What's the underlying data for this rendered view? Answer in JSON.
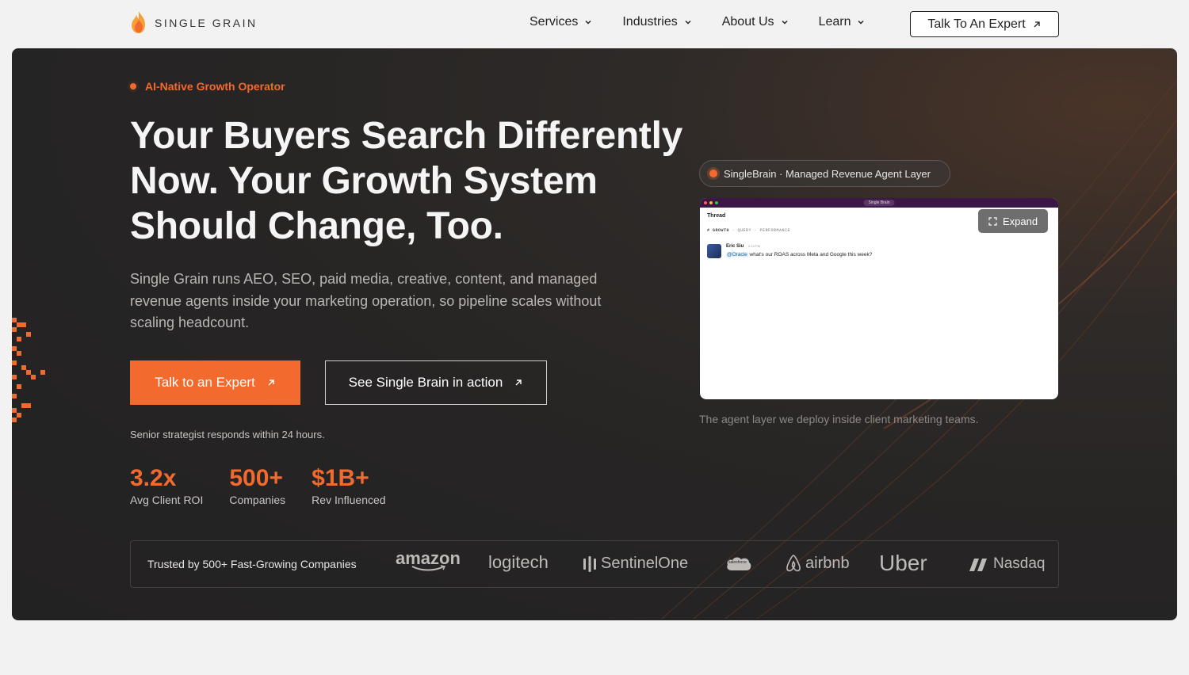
{
  "nav": {
    "logo_text": "SINGLE GRAIN",
    "items": [
      {
        "label": "Services"
      },
      {
        "label": "Industries"
      },
      {
        "label": "About Us"
      },
      {
        "label": "Learn"
      }
    ],
    "cta_label": "Talk To An Expert"
  },
  "hero": {
    "eyebrow": "AI-Native Growth Operator",
    "headline_line1": "Your Buyers Search Differently",
    "headline_line2": "Now. Your Growth System",
    "headline_line3": "Should Change, Too.",
    "subcopy": "Single Grain runs AEO, SEO, paid media, creative, content, and managed revenue agents inside your marketing operation, so pipeline scales without scaling headcount.",
    "primary_cta": "Talk to an Expert",
    "secondary_cta": "See Single Brain in action",
    "responds_note": "Senior strategist responds within 24 hours.",
    "stats": [
      {
        "value": "3.2x",
        "label": "Avg Client ROI"
      },
      {
        "value": "500+",
        "label": "Companies"
      },
      {
        "value": "$1B+",
        "label": "Rev Influenced"
      }
    ]
  },
  "agent": {
    "pill_label": "SingleBrain · Managed Revenue Agent Layer",
    "preview": {
      "bar_title": "Single Brain",
      "thread_title": "Thread",
      "channel": "# GROWTH",
      "channel_tags": "· QUERY · PERFORMANCE",
      "message_author": "Eric Siu",
      "message_time": "2:14 PM",
      "mention": "@Oracle",
      "message_text": " what's our ROAS across Meta and Google this week?",
      "expand_label": "Expand"
    },
    "caption": "The agent layer we deploy inside client marketing teams."
  },
  "trusted": {
    "label": "Trusted by 500+ Fast-Growing Companies",
    "brands": [
      "amazon",
      "logitech",
      "SentinelOne",
      "salesforce",
      "airbnb",
      "Uber",
      "Nasdaq"
    ]
  },
  "colors": {
    "accent": "#f26a2e",
    "hero_bg": "#262424",
    "page_bg": "#f2f2f2"
  }
}
